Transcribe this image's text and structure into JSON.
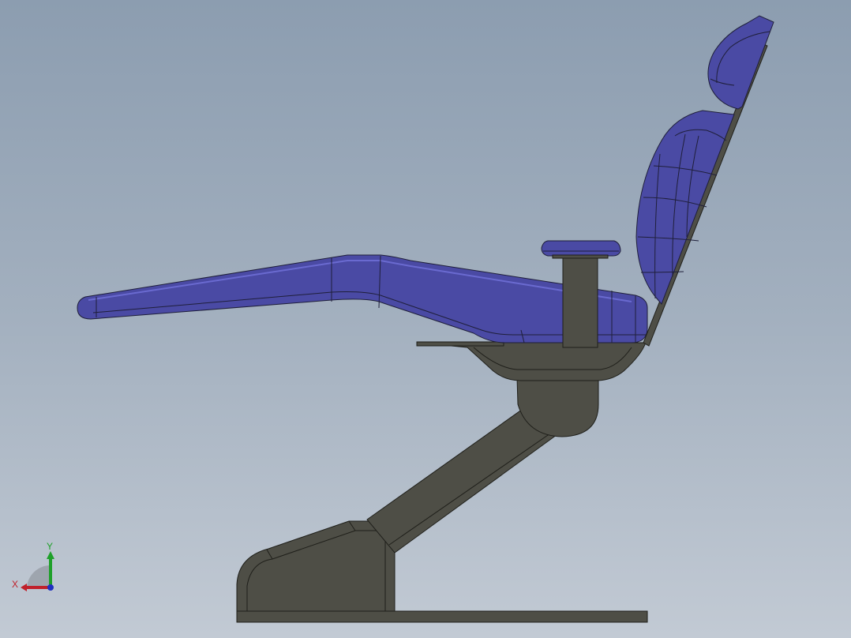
{
  "viewport": {
    "background_top": "#8c9db0",
    "background_bottom": "#c2cad4"
  },
  "model": {
    "upholstery_color": "#4a4aa4",
    "upholstery_shade": "#3c3c8a",
    "upholstery_highlight": "#5d5dc4",
    "frame_color": "#4e4e46",
    "frame_edge": "#1f1f1a",
    "parts": [
      "headrest",
      "backrest",
      "seat-cushion",
      "armrest",
      "seat-frame",
      "pivot-hub",
      "support-arm",
      "base-housing",
      "base-plate"
    ]
  },
  "triad": {
    "x_label": "X",
    "y_label": "Y",
    "x_color": "#c0202a",
    "y_color": "#1fa02a",
    "z_color": "#2030c0"
  }
}
